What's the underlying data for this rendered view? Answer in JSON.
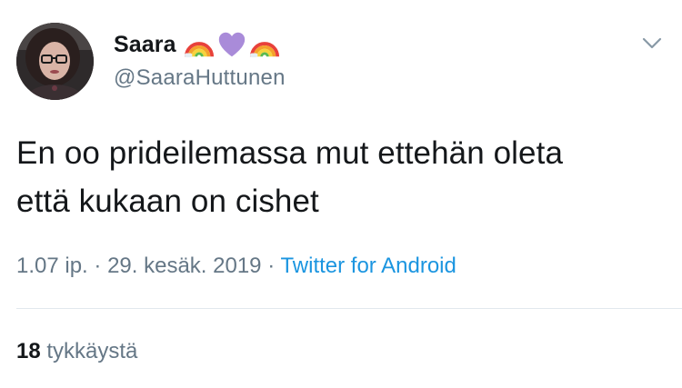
{
  "author": {
    "display_name": "Saara",
    "handle": "@SaaraHuttunen",
    "emojis": [
      "rainbow-emoji",
      "purple-heart-emoji",
      "rainbow-emoji"
    ]
  },
  "tweet": {
    "line1": "En oo prideilemassa mut ettehän oleta",
    "line2": "että kukaan on cishet"
  },
  "meta": {
    "time": "1.07 ip.",
    "separator1": "·",
    "date": "29. kesäk. 2019",
    "separator2": "·",
    "source": "Twitter for Android"
  },
  "stats": {
    "likes_count": "18",
    "likes_label": "tykkäystä"
  },
  "colors": {
    "text": "#14171a",
    "secondary": "#657786",
    "link": "#1b95e0",
    "divider": "#e1e8ed"
  }
}
